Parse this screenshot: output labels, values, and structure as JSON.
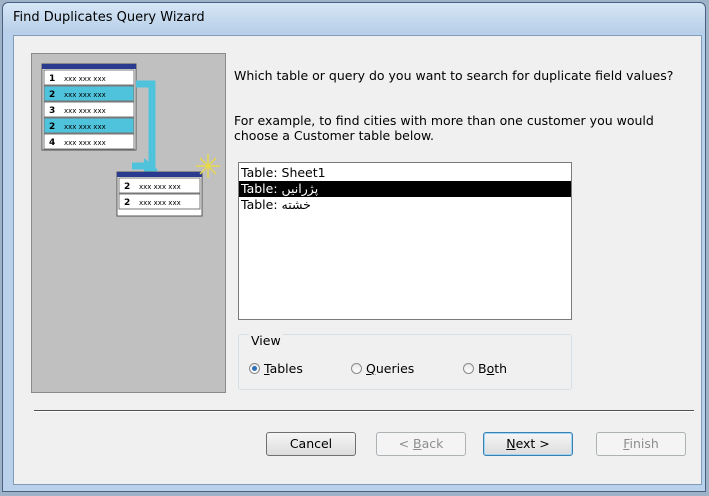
{
  "window": {
    "title": "Find Duplicates Query Wizard"
  },
  "illustration": {
    "source_rows": [
      {
        "num": "1",
        "text": "xxx xxx xxx"
      },
      {
        "num": "2",
        "text": "xxx xxx xxx"
      },
      {
        "num": "3",
        "text": "xxx xxx xxx"
      },
      {
        "num": "2",
        "text": "xxx xxx xxx"
      },
      {
        "num": "4",
        "text": "xxx xxx xxx"
      }
    ],
    "result_rows": [
      {
        "num": "2",
        "text": "xxx xxx xxx"
      },
      {
        "num": "2",
        "text": "xxx xxx xxx"
      }
    ]
  },
  "prompt": "Which table or query do you want to search for duplicate field values?",
  "example": "For example, to find cities with more than one customer you would choose a Customer table below.",
  "list": {
    "items": [
      {
        "label": "Table: Sheet1"
      },
      {
        "label": "Table: پژرانیں"
      },
      {
        "label": "Table: خشته"
      }
    ],
    "selected_index": 1
  },
  "view": {
    "legend": "View",
    "options": [
      {
        "label": "Tables",
        "accel": "T",
        "rest": "ables",
        "checked": true
      },
      {
        "label": "Queries",
        "accel": "Q",
        "rest": "ueries",
        "checked": false
      },
      {
        "label": "Both",
        "accel": "o",
        "pre": "B",
        "rest": "th",
        "checked": false
      }
    ]
  },
  "buttons": {
    "cancel": "Cancel",
    "back_pre": "< ",
    "back_accel": "B",
    "back_rest": "ack",
    "next_accel": "N",
    "next_rest": "ext >",
    "finish_accel": "F",
    "finish_rest": "inish"
  },
  "colors": {
    "accent": "#2d70b8",
    "illustration_highlight": "#4fc3dc"
  }
}
